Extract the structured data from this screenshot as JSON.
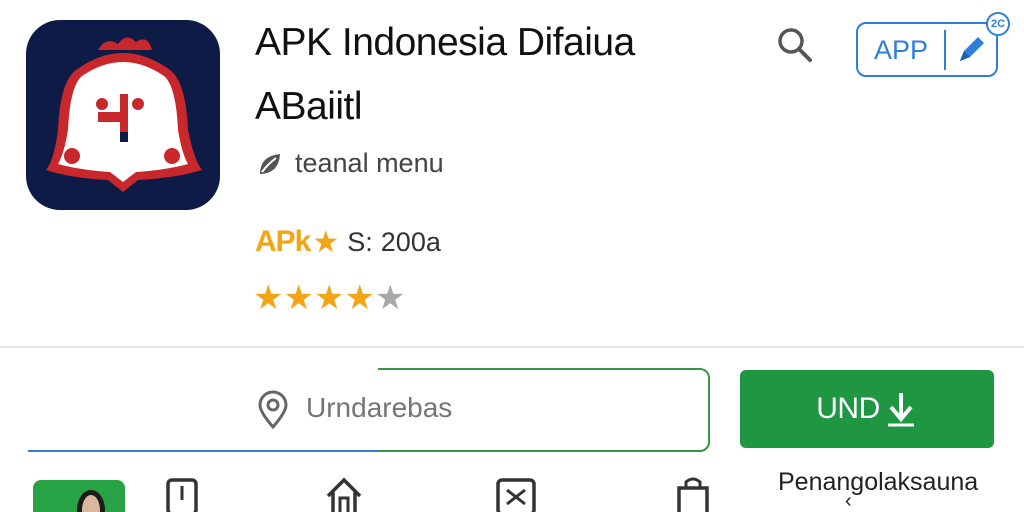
{
  "app": {
    "title_line1": "APK Indonesia Difaiua",
    "title_line2": "ABaiitl",
    "developer": "teanal menu",
    "apk_tag": "APk",
    "rating_stars_text": "★",
    "rating_prefix": "S:",
    "rating_count": "200a",
    "star_rating": 4,
    "star_max": 5
  },
  "header": {
    "badge_label": "APP",
    "badge_counter": "2C"
  },
  "search": {
    "placeholder": "Urndarebas"
  },
  "actions": {
    "primary_label": "UND"
  },
  "footer": {
    "label": "Penangolaksauna",
    "chevron": "‹"
  },
  "nav": {
    "items": [
      "book-icon",
      "home-icon",
      "crossing-icon",
      "bag-icon"
    ]
  },
  "colors": {
    "accent_blue": "#2e7fd9",
    "accent_green": "#1e9642",
    "star_gold": "#f2a516",
    "icon_bg": "#0e1b46"
  }
}
